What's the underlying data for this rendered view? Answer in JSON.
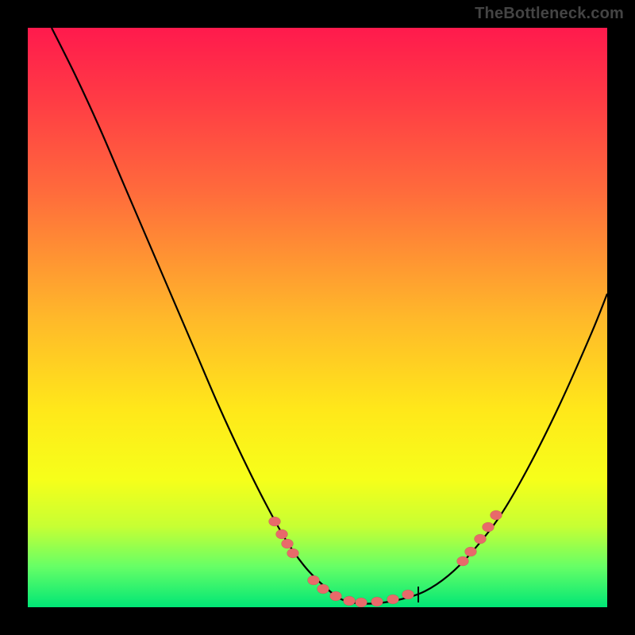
{
  "attribution": "TheBottleneck.com",
  "colors": {
    "dot": "#e86a6a",
    "curve": "#000000"
  },
  "chart_data": {
    "type": "line",
    "title": "",
    "xlabel": "",
    "ylabel": "",
    "xlim": [
      0,
      730
    ],
    "ylim": [
      0,
      730
    ],
    "grid": false,
    "series": [
      {
        "name": "bottleneck-curve",
        "x": [
          30,
          60,
          90,
          120,
          150,
          180,
          210,
          240,
          270,
          300,
          325,
          350,
          375,
          395,
          415,
          440,
          470,
          500,
          530,
          560,
          595,
          630,
          670,
          710,
          730
        ],
        "y": [
          0,
          60,
          125,
          195,
          265,
          335,
          405,
          475,
          540,
          600,
          645,
          680,
          705,
          720,
          725,
          725,
          720,
          710,
          690,
          660,
          615,
          555,
          475,
          385,
          335
        ],
        "note": "y measured from top of plot area (0=top, 730=bottom); curve is a V/U shape with minimum near x≈410"
      }
    ],
    "dots": {
      "note": "highlighted points on the curve near the bottom basin and its shoulders",
      "points": [
        {
          "x": 311,
          "y": 622
        },
        {
          "x": 320,
          "y": 638
        },
        {
          "x": 327,
          "y": 650
        },
        {
          "x": 334,
          "y": 662
        },
        {
          "x": 360,
          "y": 696
        },
        {
          "x": 372,
          "y": 707
        },
        {
          "x": 388,
          "y": 716
        },
        {
          "x": 405,
          "y": 722
        },
        {
          "x": 420,
          "y": 724
        },
        {
          "x": 440,
          "y": 723
        },
        {
          "x": 460,
          "y": 720
        },
        {
          "x": 479,
          "y": 714
        },
        {
          "x": 548,
          "y": 672
        },
        {
          "x": 558,
          "y": 660
        },
        {
          "x": 570,
          "y": 644
        },
        {
          "x": 580,
          "y": 629
        },
        {
          "x": 590,
          "y": 614
        }
      ]
    },
    "tick": {
      "x": 492,
      "y1": 704,
      "y2": 724
    }
  }
}
